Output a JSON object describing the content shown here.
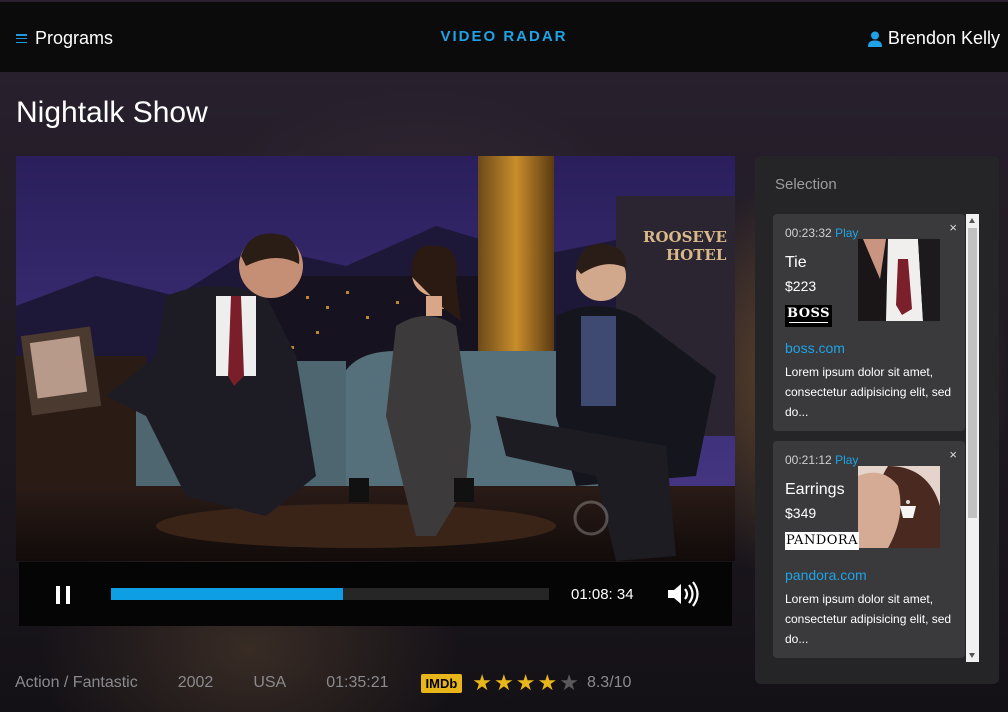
{
  "header": {
    "menu_label": "Programs",
    "brand": "VIDEO RADAR",
    "user_name": "Brendon Kelly",
    "accent": "#1fa3e6"
  },
  "page": {
    "title": "Nightalk Show"
  },
  "video": {
    "sign_line1": "ROOSEVE",
    "sign_line2": "HOTEL"
  },
  "player": {
    "time": "01:08: 34",
    "progress_percent": 53
  },
  "meta": {
    "genre": "Action / Fantastic",
    "year": "2002",
    "country": "USA",
    "duration": "01:35:21",
    "imdb_label": "IMDb",
    "stars_filled": 4,
    "stars_total": 5,
    "rating": "8.3/10"
  },
  "selection": {
    "title": "Selection",
    "items": [
      {
        "timestamp": "00:23:32",
        "play": "Play",
        "close": "×",
        "name": "Tie",
        "price": "$223",
        "brand_logo": "BOSS",
        "link": "boss.com",
        "description": "Lorem ipsum dolor sit amet, consectetur adipisicing elit, sed do..."
      },
      {
        "timestamp": "00:21:12",
        "play": "Play",
        "close": "×",
        "name": "Earrings",
        "price": "$349",
        "brand_logo": "PANDORA",
        "link": "pandora.com",
        "description": "Lorem ipsum dolor sit amet, consectetur adipisicing elit, sed do..."
      }
    ]
  }
}
